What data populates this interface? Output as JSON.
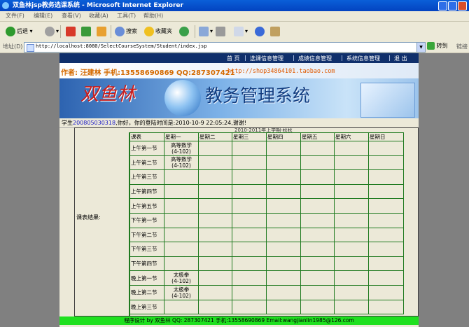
{
  "window": {
    "title": "双鱼林jsp教务选课系统 - Microsoft Internet Explorer"
  },
  "menu": [
    "文件(F)",
    "编辑(E)",
    "查看(V)",
    "收藏(A)",
    "工具(T)",
    "帮助(H)"
  ],
  "toolbar": {
    "back": "后退",
    "search": "搜索",
    "favorites": "收藏夹"
  },
  "address": {
    "label": "地址(D)",
    "url": "http://localhost:8080/SelectCourseSystem/Student/index.jsp",
    "go": "转到",
    "links": "链接"
  },
  "nav": {
    "home": "首 页",
    "course_info": "选课信息管理",
    "grade_info": "成绩信息管理",
    "system_info": "系统信息管理",
    "logout": "退 出"
  },
  "banner": {
    "author": "作者: 汪建林  手机:13558690869 QQ:287307421",
    "shop": "http://shop34864101.taobao.com",
    "system_prefix": "双鱼林",
    "system_name": "教务管理系统"
  },
  "welcome": {
    "prefix": "学生",
    "student_id": "200805030318",
    "suffix": ",你好，你的登陆时间是:2010-10-9 22:05:24,谢谢!"
  },
  "result_label": "课表结果:",
  "semester": "2010-2011年上学期-秋秋",
  "schedule": {
    "header": [
      "课表",
      "星期一",
      "星期二",
      "星期三",
      "星期四",
      "星期五",
      "星期六",
      "星期日"
    ],
    "rows": [
      {
        "period": "上午第一节",
        "cells": [
          "高等数学\n(4-102)",
          "",
          "",
          "",
          "",
          "",
          ""
        ]
      },
      {
        "period": "上午第二节",
        "cells": [
          "高等数学\n(4-102)",
          "",
          "",
          "",
          "",
          "",
          ""
        ]
      },
      {
        "period": "上午第三节",
        "cells": [
          "",
          "",
          "",
          "",
          "",
          "",
          ""
        ]
      },
      {
        "period": "上午第四节",
        "cells": [
          "",
          "",
          "",
          "",
          "",
          "",
          ""
        ]
      },
      {
        "period": "上午第五节",
        "cells": [
          "",
          "",
          "",
          "",
          "",
          "",
          ""
        ]
      },
      {
        "period": "下午第一节",
        "cells": [
          "",
          "",
          "",
          "",
          "",
          "",
          ""
        ]
      },
      {
        "period": "下午第二节",
        "cells": [
          "",
          "",
          "",
          "",
          "",
          "",
          ""
        ]
      },
      {
        "period": "下午第三节",
        "cells": [
          "",
          "",
          "",
          "",
          "",
          "",
          ""
        ]
      },
      {
        "period": "下午第四节",
        "cells": [
          "",
          "",
          "",
          "",
          "",
          "",
          ""
        ]
      },
      {
        "period": "晚上第一节",
        "cells": [
          "太极拳\n(4-102)",
          "",
          "",
          "",
          "",
          "",
          ""
        ]
      },
      {
        "period": "晚上第二节",
        "cells": [
          "太极拳\n(4-102)",
          "",
          "",
          "",
          "",
          "",
          ""
        ]
      },
      {
        "period": "晚上第三节",
        "cells": [
          "",
          "",
          "",
          "",
          "",
          "",
          ""
        ]
      }
    ]
  },
  "footer": "程序设计 by 双鱼林  QQ: 287307421 手机:13558690869 Email:wangjianlin1985@126.com",
  "colors": {
    "titlebar": "#0a5fd8",
    "nav": "#0f2f6b",
    "grid": "#1f7a1f",
    "footer": "#1fe01f",
    "author": "#d46a00"
  }
}
